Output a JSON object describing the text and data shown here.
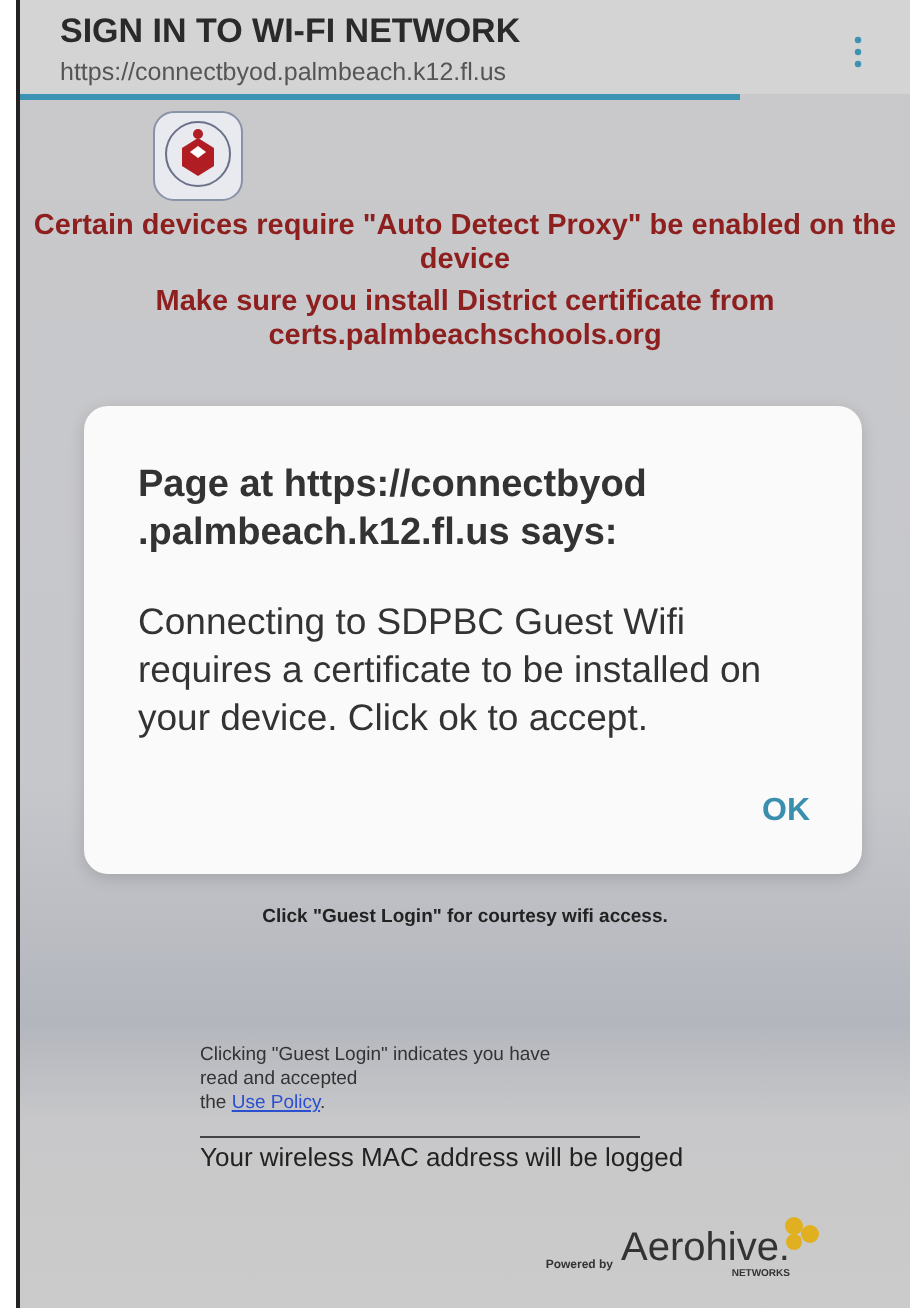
{
  "header": {
    "title": "SIGN IN TO WI-FI NETWORK",
    "url": "https://connectbyod.palmbeach.k12.fl.us",
    "progress": {
      "level": 0.81
    }
  },
  "notices": [
    "Certain devices require \"Auto Detect Proxy\" be enabled on the device",
    "Make sure you install District certificate from certs.palmbeachschools.org"
  ],
  "dialog": {
    "title": "Page at https://connectbyod .palmbeach.k12.fl.us says:",
    "message": "Connecting to SDPBC Guest Wifi requires a certificate to be installed on your device. Click ok to accept.",
    "button": "OK"
  },
  "guest_hint": "Click \"Guest Login\" for courtesy wifi access.",
  "policy": {
    "lines": [
      "Clicking \"Guest Login\" indicates you have",
      "read and accepted",
      "the"
    ],
    "link": "Use Policy",
    "after": "."
  },
  "mac_notice": "Your wireless MAC address will be logged",
  "footer": {
    "powered_by": "Powered by",
    "brand": "Aerohive.",
    "sub": "NETWORKS"
  }
}
